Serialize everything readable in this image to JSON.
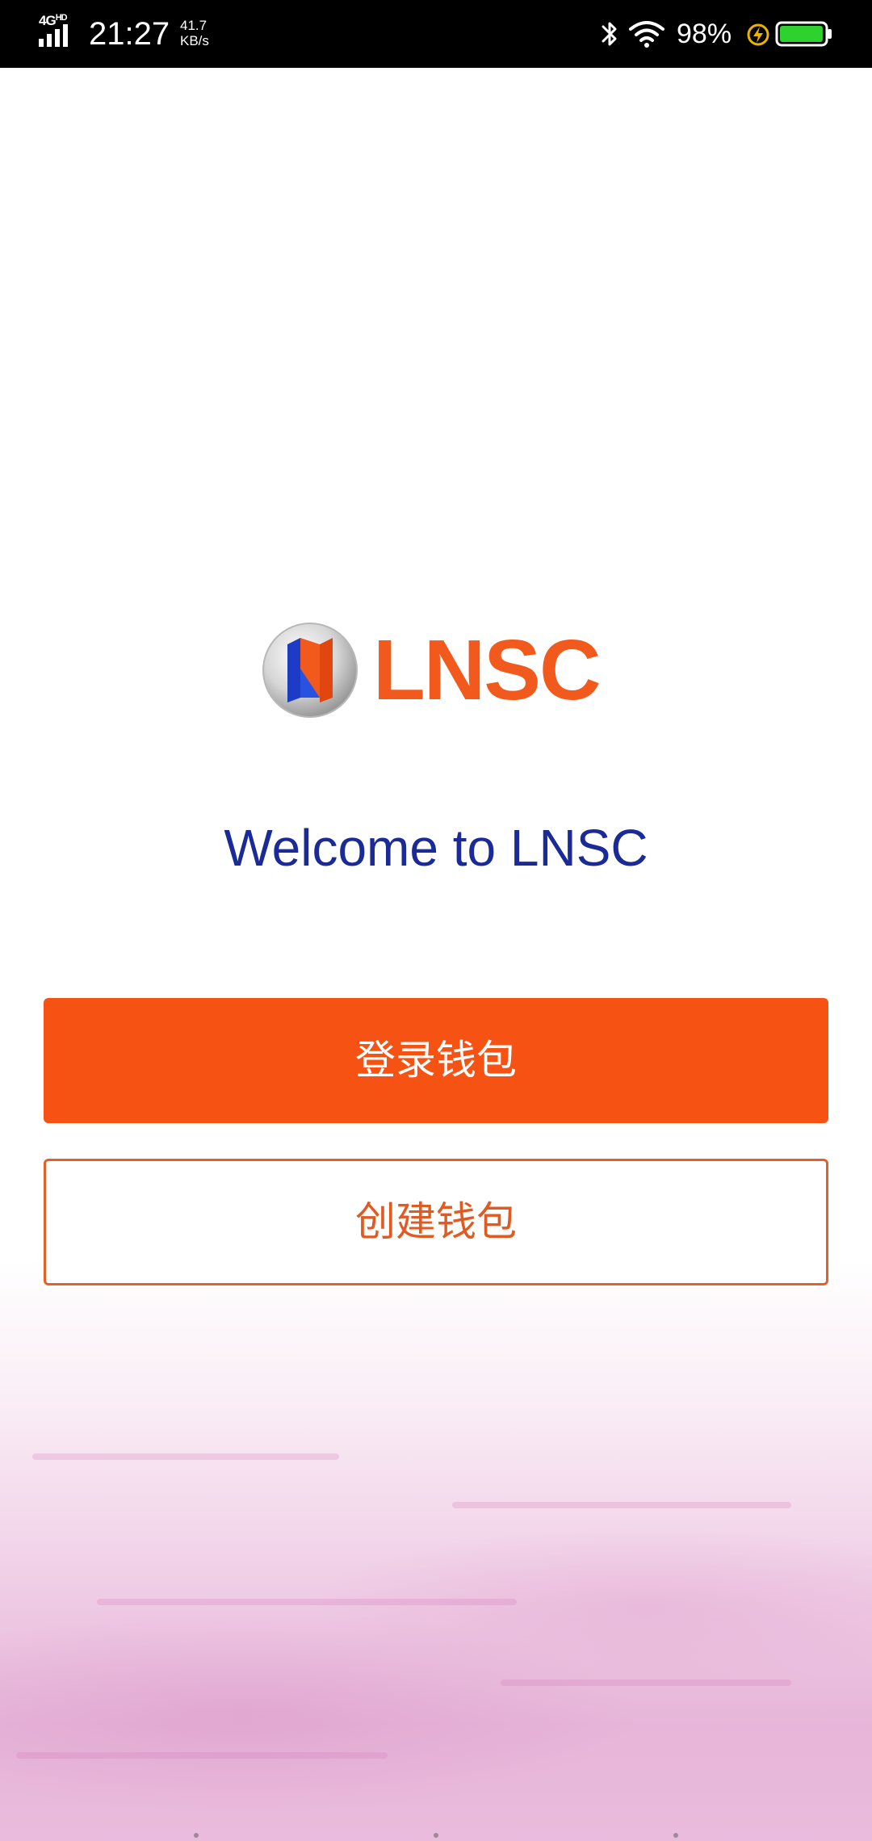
{
  "status_bar": {
    "network": "4G",
    "hd": "HD",
    "time": "21:27",
    "speed_value": "41.7",
    "speed_unit": "KB/s",
    "battery_percent": "98%",
    "battery_level": 0.98,
    "icons": [
      "signal-icon",
      "bluetooth-icon",
      "wifi-icon",
      "charging-icon",
      "battery-icon"
    ]
  },
  "logo": {
    "text": "LNSC"
  },
  "welcome": {
    "title": "Welcome to LNSC"
  },
  "actions": {
    "login_label": "登录钱包",
    "create_label": "创建钱包"
  },
  "colors": {
    "primary": "#f65214",
    "logo_orange": "#f15a1c",
    "title_blue": "#1a2a96",
    "status_bar": "#000000",
    "battery_green": "#2ed22e"
  }
}
